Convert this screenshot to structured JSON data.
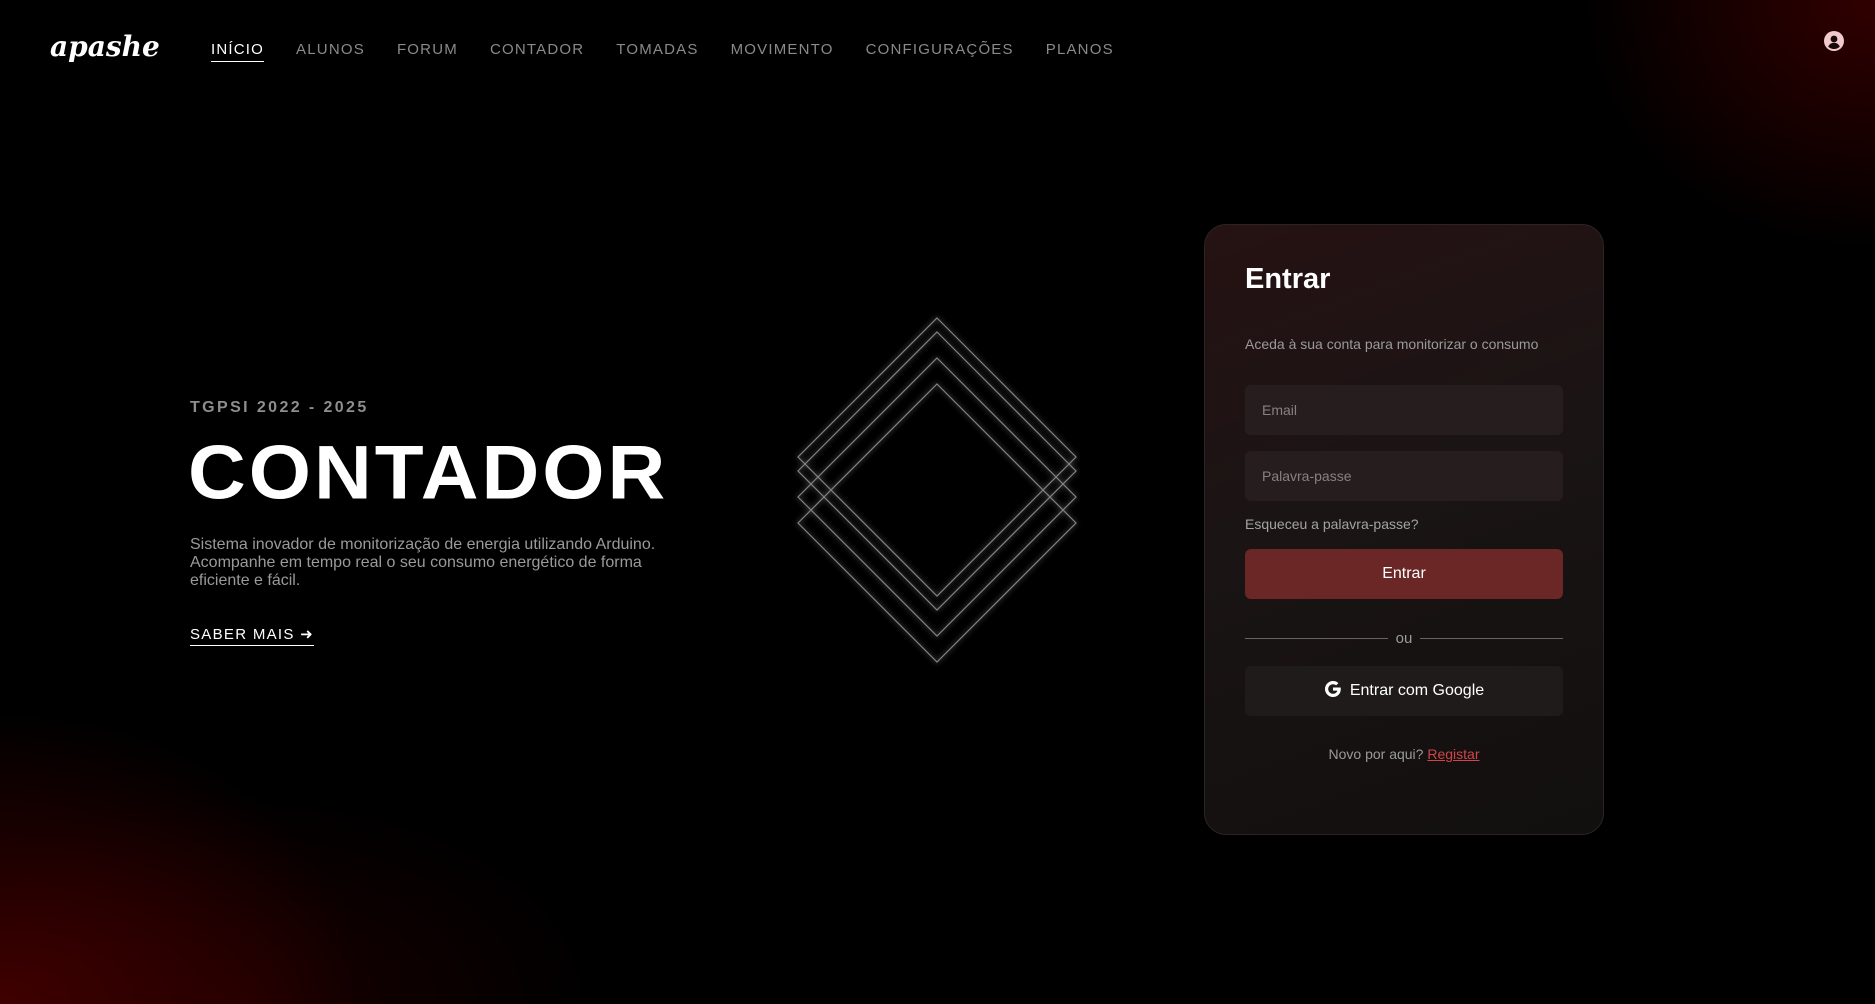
{
  "brand": {
    "logo_text": "apashe"
  },
  "nav": {
    "items": [
      {
        "label": "INÍCIO",
        "active": true
      },
      {
        "label": "ALUNOS",
        "active": false
      },
      {
        "label": "FORUM",
        "active": false
      },
      {
        "label": "CONTADOR",
        "active": false
      },
      {
        "label": "TOMADAS",
        "active": false
      },
      {
        "label": "MOVIMENTO",
        "active": false
      },
      {
        "label": "CONFIGURAÇÕES",
        "active": false
      },
      {
        "label": "PLANOS",
        "active": false
      }
    ],
    "user_icon": "user-circle-icon"
  },
  "hero": {
    "subtitle": "TGPSI 2022 - 2025",
    "title": "CONTADOR",
    "description": "Sistema inovador de monitorização de energia utilizando Arduino. Acompanhe em tempo real o seu consumo energético de forma eficiente e fácil.",
    "cta_label": "SABER MAIS ➜",
    "decoration_icon": "diamond-lines-icon"
  },
  "login": {
    "title": "Entrar",
    "subtitle": "Aceda à sua conta para monitorizar o consumo",
    "email": {
      "placeholder": "Email",
      "value": ""
    },
    "password": {
      "placeholder": "Palavra-passe",
      "value": ""
    },
    "forgot_label": "Esqueceu a palavra-passe?",
    "submit_label": "Entrar",
    "divider_label": "ou",
    "google_label": "Entrar com Google",
    "google_icon": "google-icon",
    "register_prompt": "Novo por aqui?",
    "register_link": "Registar"
  },
  "colors": {
    "background": "#000000",
    "accent_red": "#6b2626",
    "link_red": "#d0454a",
    "card_bg": "#1a1414",
    "input_bg": "#261e1e",
    "nav_text": "#8a8a8a"
  }
}
